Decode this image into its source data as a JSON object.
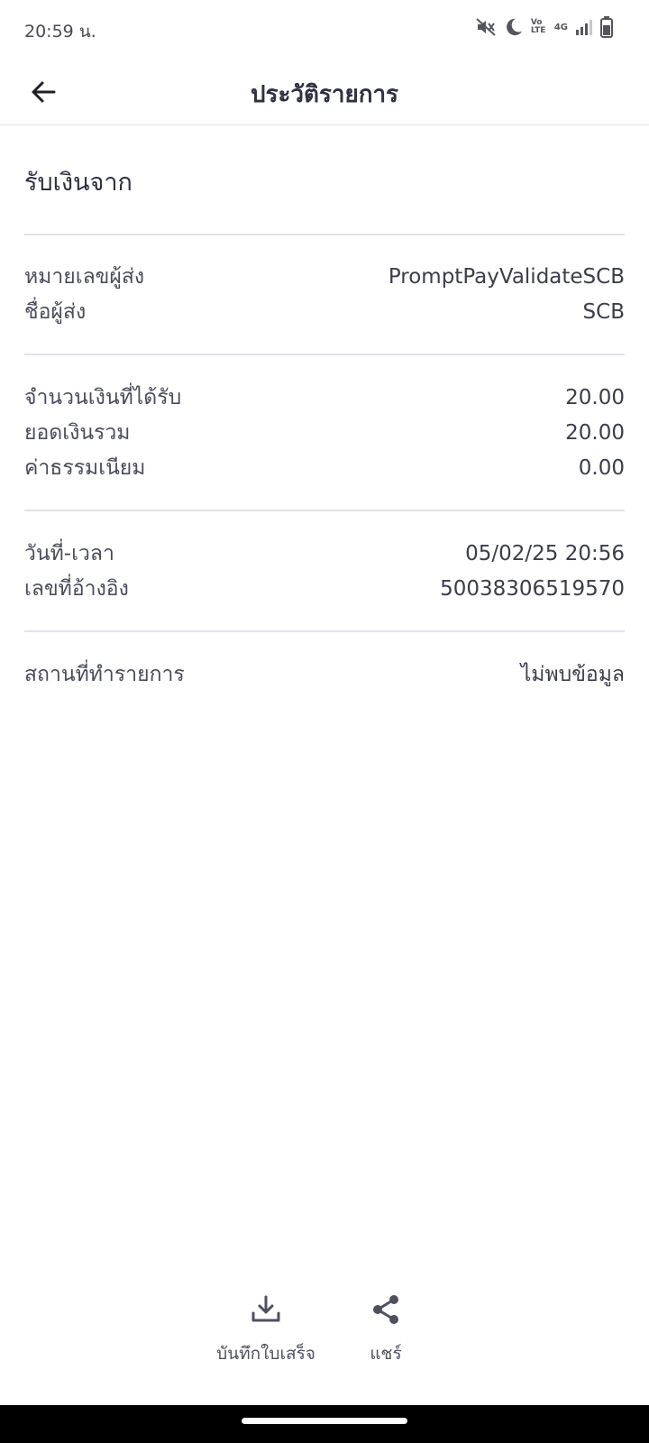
{
  "status_bar": {
    "time": "20:59 น.",
    "network_label": "4G",
    "volte_label": "Vo LTE",
    "icons": [
      "mute-icon",
      "do-not-disturb-icon",
      "volte-icon",
      "signal-icon",
      "battery-icon"
    ]
  },
  "header": {
    "title": "ประวัติรายการ",
    "back_icon": "arrow-left-icon"
  },
  "transaction": {
    "type_heading": "รับเงินจาก",
    "sender": [
      {
        "label": "หมายเลขผู้ส่ง",
        "value": "PromptPayValidateSCB"
      },
      {
        "label": "ชื่อผู้ส่ง",
        "value": "SCB"
      }
    ],
    "amounts": [
      {
        "label": "จำนวนเงินที่ได้รับ",
        "value": "20.00"
      },
      {
        "label": "ยอดเงินรวม",
        "value": "20.00"
      },
      {
        "label": "ค่าธรรมเนียม",
        "value": "0.00"
      }
    ],
    "meta": [
      {
        "label": "วันที่-เวลา",
        "value": "05/02/25 20:56"
      },
      {
        "label": "เลขที่อ้างอิง",
        "value": "50038306519570"
      }
    ],
    "location": {
      "label": "สถานที่ทำรายการ",
      "value": "ไม่พบข้อมูล"
    }
  },
  "actions": {
    "save_receipt": {
      "label": "บันทึกใบเสร็จ",
      "icon": "download-icon"
    },
    "share": {
      "label": "แชร์",
      "icon": "share-icon"
    }
  },
  "colors": {
    "text_primary": "#2f3042",
    "text_secondary": "#4a4b5c",
    "divider": "#e1e1ea",
    "background": "#ffffff"
  }
}
